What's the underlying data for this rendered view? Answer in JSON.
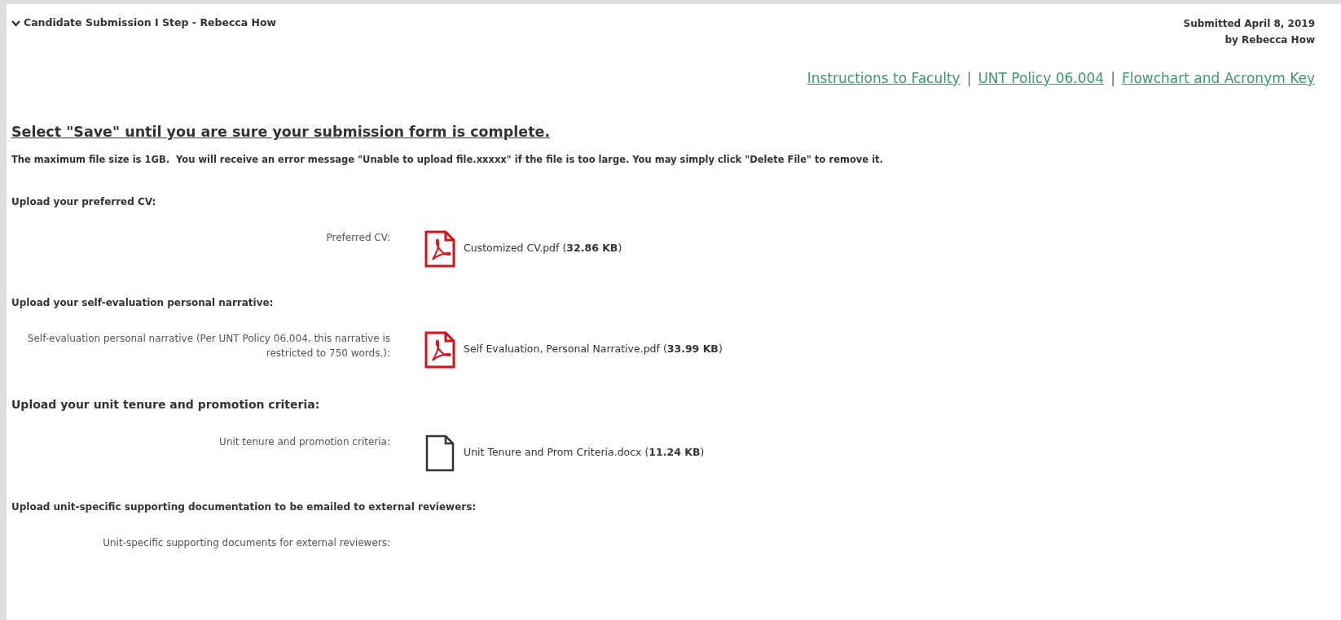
{
  "header": {
    "title": "Candidate Submission I Step - Rebecca How",
    "expanded": true,
    "submitted": "Submitted April 8, 2019",
    "by": "by Rebecca How"
  },
  "links": [
    "Instructions to Faculty",
    "UNT Policy 06.004",
    "Flowchart and Acronym Key"
  ],
  "link_separators": [
    "|",
    "|"
  ],
  "heading": "Select \"Save\" until you are sure your submission form is complete.",
  "note": "The maximum file size is 1GB.  You will receive an error message \"Unable to upload file.xxxxx\" if the file is too large. You may simply click \"Delete File\" to remove it.",
  "sections": [
    {
      "title": "Upload your preferred CV:",
      "fields": [
        {
          "label": "Preferred CV:",
          "file": {
            "kind": "pdf",
            "text": "Customized CV.pdf (**32.86 KB**)"
          }
        }
      ]
    },
    {
      "title": "Upload your self-evaluation personal narrative:",
      "fields": [
        {
          "label": "Self-evaluation personal narrative (Per UNT Policy 06.004, this narrative is restricted to 750 words.):",
          "file": {
            "kind": "pdf",
            "text": "Self Evaluation, Personal Narrative.pdf (**33.99 KB**)"
          }
        }
      ]
    },
    {
      "title": "Upload your unit tenure and promotion criteria:",
      "fields": [
        {
          "label": "Unit tenure and promotion criteria:",
          "file": {
            "kind": "doc",
            "text": "Unit Tenure and Prom Criteria.docx (**11.24 KB**)"
          }
        }
      ]
    },
    {
      "title": "Upload unit-specific supporting documentation to be emailed to external reviewers:",
      "fields": [
        {
          "label": "Unit-specific supporting documents for external reviewers:"
        }
      ]
    }
  ]
}
